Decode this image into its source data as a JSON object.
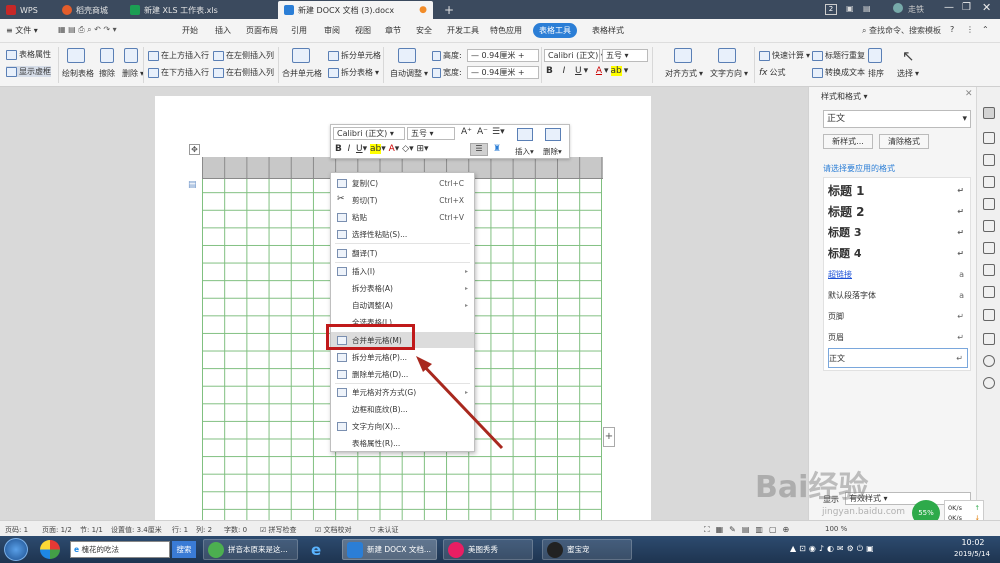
{
  "tabs": {
    "wps": "WPS",
    "shop": "稻壳商城",
    "xls": "新建 XLS 工作表.xls",
    "docx": "新建 DOCX 文档 (3).docx",
    "add": "+",
    "badge": "2",
    "user": "走铁"
  },
  "menubar": {
    "file": "文件",
    "items": [
      "开始",
      "插入",
      "页面布局",
      "引用",
      "审阅",
      "视图",
      "章节",
      "安全",
      "开发工具",
      "特色应用",
      "表格工具",
      "表格样式"
    ],
    "search": "查找命令、搜索模板"
  },
  "ribbon": {
    "table_props": "表格属性",
    "show_grid": "显示虚框",
    "draw_table": "绘制表格",
    "erase": "擦除",
    "delete": "删除",
    "ins_above": "在上方插入行",
    "ins_below": "在下方插入行",
    "ins_left": "在左侧插入列",
    "ins_right": "在右侧插入列",
    "merge": "合并单元格",
    "split_cells": "拆分单元格",
    "split_table": "拆分表格",
    "auto_fit": "自动调整",
    "height_label": "高度:",
    "width_label": "宽度:",
    "height_value": "0.94厘米",
    "width_value": "0.94厘米",
    "font": "Calibri (正文)",
    "size": "五号",
    "align": "对齐方式",
    "text_dir": "文字方向",
    "quick_calc": "快速计算",
    "title_repeat": "标题行重复",
    "formula": "公式",
    "to_text": "转换成文本",
    "sort": "排序",
    "select": "选择"
  },
  "minibar": {
    "font": "Calibri (正文)",
    "size": "五号",
    "insert": "插入",
    "delete": "删除"
  },
  "context_menu": [
    {
      "label": "复制(C)",
      "key": "Ctrl+C"
    },
    {
      "label": "剪切(T)",
      "key": "Ctrl+X"
    },
    {
      "label": "粘贴",
      "key": "Ctrl+V"
    },
    {
      "label": "选择性粘贴(S)...",
      "key": ""
    },
    {
      "label": "翻译(T)",
      "key": ""
    },
    {
      "label": "插入(I)",
      "key": ""
    },
    {
      "label": "拆分表格(A)",
      "key": ""
    },
    {
      "label": "自动调整(A)",
      "key": ""
    },
    {
      "label": "全选表格(L)",
      "key": ""
    },
    {
      "label": "合并单元格(M)",
      "key": ""
    },
    {
      "label": "拆分单元格(P)...",
      "key": ""
    },
    {
      "label": "删除单元格(D)...",
      "key": ""
    },
    {
      "label": "单元格对齐方式(G)",
      "key": ""
    },
    {
      "label": "边框和底纹(B)...",
      "key": ""
    },
    {
      "label": "文字方向(X)...",
      "key": ""
    },
    {
      "label": "表格属性(R)...",
      "key": ""
    }
  ],
  "side_pane": {
    "title": "样式和格式",
    "current": "正文",
    "new_style": "新样式...",
    "clear_format": "清除格式",
    "apply_label": "请选择要应用的格式",
    "styles": [
      "标题 1",
      "标题 2",
      "标题 3",
      "标题 4",
      "超链接",
      "默认段落字体",
      "页脚",
      "页眉",
      "正文"
    ],
    "show_label": "显示",
    "show_value": "有效样式"
  },
  "statusbar": {
    "page": "页码: 1",
    "pages": "页面: 1/2",
    "section": "节: 1/1",
    "setting": "设置值: 3.4厘米",
    "row": "行: 1",
    "col": "列: 2",
    "words": "字数: 0",
    "spell": "拼写检查",
    "proof": "文档校对",
    "cert": "未认证",
    "zoom": "100 %"
  },
  "network": {
    "up": "0K/s",
    "down": "0K/s",
    "pct": "55%"
  },
  "taskbar": {
    "search_text": "槐花的吃法",
    "search_btn": "搜索",
    "app1": "拼音本原来是这...",
    "app2": "新建 DOCX 文档...",
    "app3": "美图秀秀",
    "app4": "蜜宝宠",
    "time": "10:02",
    "date": "2019/5/14"
  },
  "watermark": {
    "logo": "Bai经验",
    "url": "jingyan.baidu.com"
  },
  "colors": {
    "accent": "#2b7ed6",
    "table_line": "#7fbf7f",
    "highlight_box": "#c0191a",
    "arrow": "#a8281e"
  }
}
